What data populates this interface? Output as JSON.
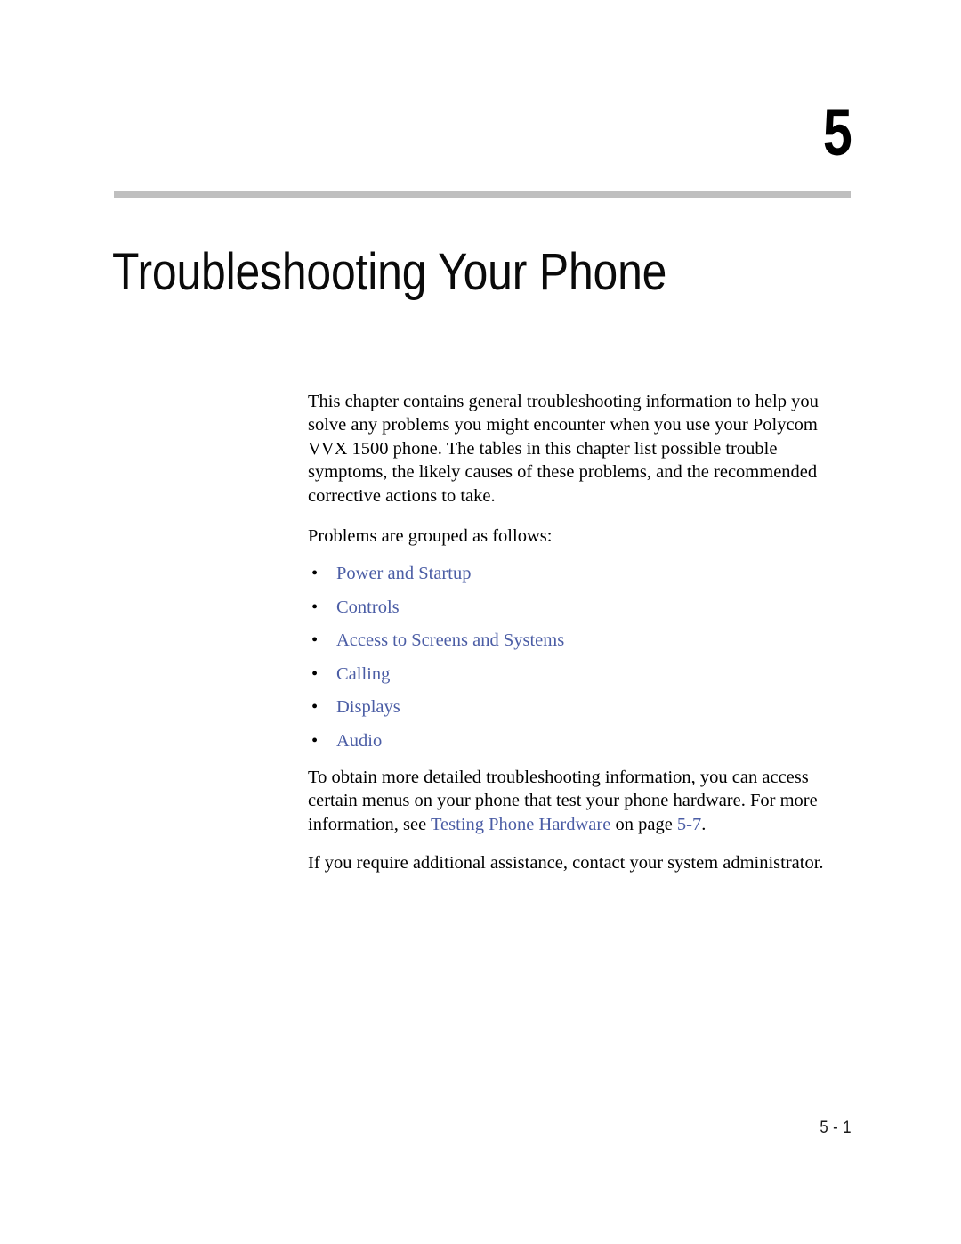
{
  "chapter": {
    "number": "5",
    "title": "Troubleshooting Your Phone"
  },
  "intro": {
    "paragraph": "This chapter contains general troubleshooting information to help you solve any problems you might encounter when you use your Polycom VVX 1500 phone. The tables in this chapter list possible trouble symptoms, the likely causes of these problems, and the recommended corrective actions to take.",
    "grouped_lead": "Problems are grouped as follows:"
  },
  "topic_links": [
    {
      "bullet": "•",
      "label": "Power and Startup"
    },
    {
      "bullet": "•",
      "label": "Controls"
    },
    {
      "bullet": "•",
      "label": "Access to Screens and Systems"
    },
    {
      "bullet": "•",
      "label": "Calling"
    },
    {
      "bullet": "•",
      "label": "Displays"
    },
    {
      "bullet": "•",
      "label": "Audio"
    }
  ],
  "detail": {
    "text_before_link": "To obtain more detailed troubleshooting information, you can access certain menus on your phone that test your phone hardware. For more information, see ",
    "cross_reference_label": "Testing Phone Hardware",
    "text_between": " on page ",
    "cross_reference_page": "5-7",
    "text_after": "."
  },
  "assistance": {
    "paragraph": "If you require additional assistance, contact your system administrator."
  },
  "footer": {
    "page_label": "5 - 1"
  },
  "colors": {
    "link_blue": "#4b5da5",
    "rule_gray": "#bfbfbf",
    "text_black": "#000000"
  }
}
